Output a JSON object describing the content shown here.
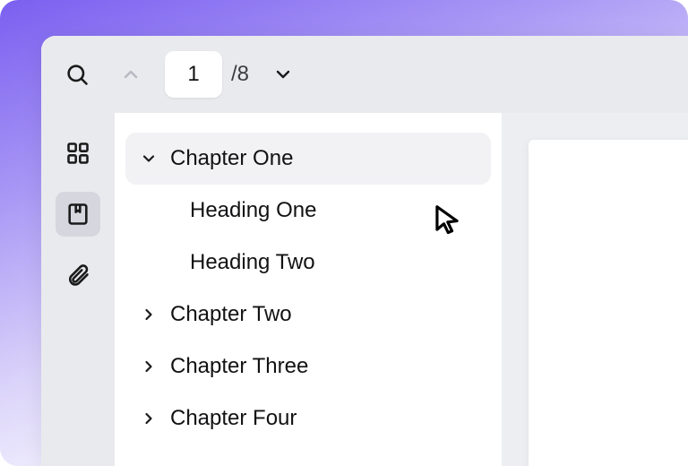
{
  "toolbar": {
    "current_page": "1",
    "total_pages": "/8"
  },
  "outline": {
    "items": [
      {
        "label": "Chapter One",
        "expanded": true,
        "children": [
          {
            "label": "Heading One"
          },
          {
            "label": "Heading Two"
          }
        ]
      },
      {
        "label": "Chapter Two",
        "expanded": false
      },
      {
        "label": "Chapter Three",
        "expanded": false
      },
      {
        "label": "Chapter Four",
        "expanded": false
      }
    ]
  }
}
